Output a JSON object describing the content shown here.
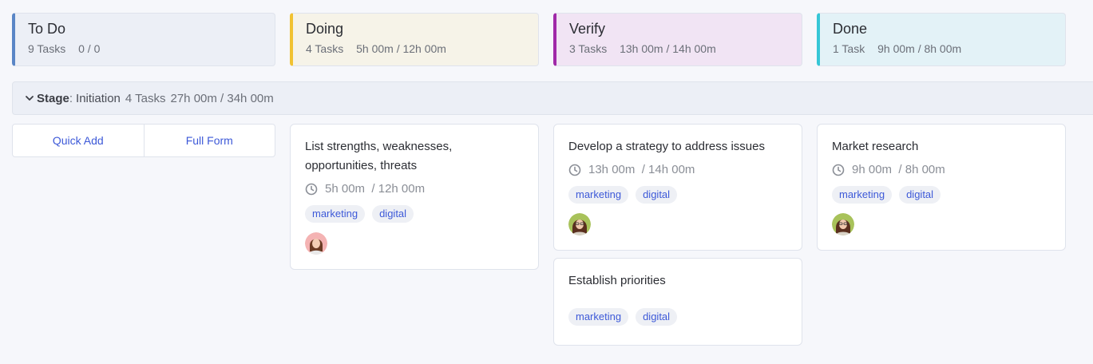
{
  "columns": [
    {
      "name": "To Do",
      "tasks": "9 Tasks",
      "hours": "0 / 0",
      "color": "#5a86c6"
    },
    {
      "name": "Doing",
      "tasks": "4 Tasks",
      "hours": "5h 00m / 12h 00m",
      "color": "#f1c232"
    },
    {
      "name": "Verify",
      "tasks": "3 Tasks",
      "hours": "13h 00m / 14h 00m",
      "color": "#a02aa8"
    },
    {
      "name": "Done",
      "tasks": "1 Task",
      "hours": "9h 00m / 8h 00m",
      "color": "#36c6d6"
    }
  ],
  "stage": {
    "icon": "chevron-down-icon",
    "label": "Stage",
    "separator": ":",
    "value": "Initiation",
    "tasks": "4 Tasks",
    "hours": "27h 00m / 34h 00m"
  },
  "quick_add": {
    "quick_label": "Quick Add",
    "full_label": "Full Form"
  },
  "cards": [
    {
      "title": "List strengths, weaknesses, opportunities, threats",
      "spent": "5h 00m",
      "estimate": "/ 12h 00m",
      "tags": [
        "marketing",
        "digital"
      ]
    },
    {
      "title": "Develop a strategy to address issues",
      "spent": "13h 00m",
      "estimate": "/ 14h 00m",
      "tags": [
        "marketing",
        "digital"
      ]
    },
    {
      "title": "Establish priorities",
      "tags": [
        "marketing",
        "digital"
      ]
    },
    {
      "title": "Market research",
      "spent": "9h 00m",
      "estimate": "/ 8h 00m",
      "tags": [
        "marketing",
        "digital"
      ]
    }
  ],
  "accent_color": "#3d59d8"
}
